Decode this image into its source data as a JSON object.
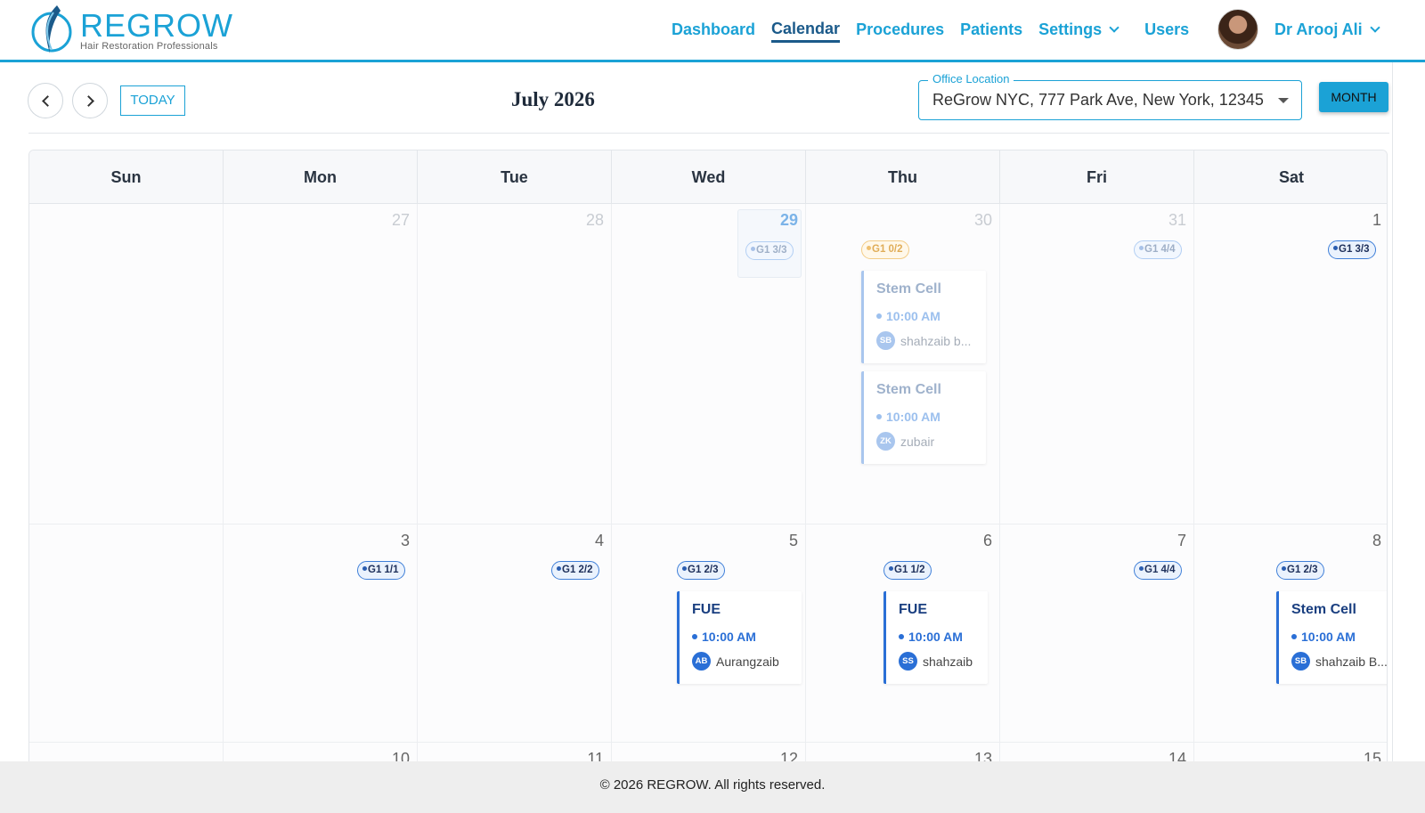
{
  "brand": {
    "name": "REGROW",
    "tagline": "Hair Restoration Professionals",
    "color": "#1ba2d6"
  },
  "nav": {
    "items": [
      {
        "label": "Dashboard",
        "active": false
      },
      {
        "label": "Calendar",
        "active": true
      },
      {
        "label": "Procedures",
        "active": false
      },
      {
        "label": "Patients",
        "active": false
      },
      {
        "label": "Settings",
        "active": false,
        "dropdown": true
      },
      {
        "label": "Users",
        "active": false
      }
    ],
    "user_name": "Dr Arooj Ali"
  },
  "toolbar": {
    "today_label": "TODAY",
    "title": "July 2026",
    "office_label": "Office Location",
    "office_value": "ReGrow NYC, 777 Park Ave, New York, 12345",
    "view_label": "MONTH"
  },
  "calendar": {
    "days_of_week": [
      "Sun",
      "Mon",
      "Tue",
      "Wed",
      "Thu",
      "Fri",
      "Sat"
    ],
    "week1": {
      "dates": [
        "",
        "27",
        "28",
        "29",
        "30",
        "31",
        "1"
      ],
      "badges": {
        "wed": "G1 3/3",
        "thu": "G1 0/2",
        "fri": "G1 4/4",
        "sat": "G1 3/3"
      },
      "appointments": [
        {
          "title": "Stem Cell",
          "time": "10:00 AM",
          "initials": "SB",
          "patient": "shahzaib b..."
        },
        {
          "title": "Stem Cell",
          "time": "10:00 AM",
          "initials": "ZK",
          "patient": "zubair"
        }
      ]
    },
    "week2": {
      "dates": [
        "",
        "3",
        "4",
        "5",
        "6",
        "7",
        "8"
      ],
      "badges": {
        "mon": "G1 1/1",
        "tue": "G1 2/2",
        "wed": "G1 2/3",
        "thu": "G1 1/2",
        "fri": "G1 4/4",
        "sat": "G1 2/3"
      },
      "appointments": [
        {
          "title": "FUE",
          "time": "10:00 AM",
          "initials": "AB",
          "patient": "Aurangzaib"
        },
        {
          "title": "FUE",
          "time": "10:00 AM",
          "initials": "SS",
          "patient": "shahzaib"
        },
        {
          "title": "Stem Cell",
          "time": "10:00 AM",
          "initials": "SB",
          "patient": "shahzaib B..."
        }
      ]
    },
    "week3": {
      "dates": [
        "",
        "10",
        "11",
        "12",
        "13",
        "14",
        "15"
      ]
    }
  },
  "footer": {
    "text": "© 2026 REGROW. All rights reserved."
  }
}
